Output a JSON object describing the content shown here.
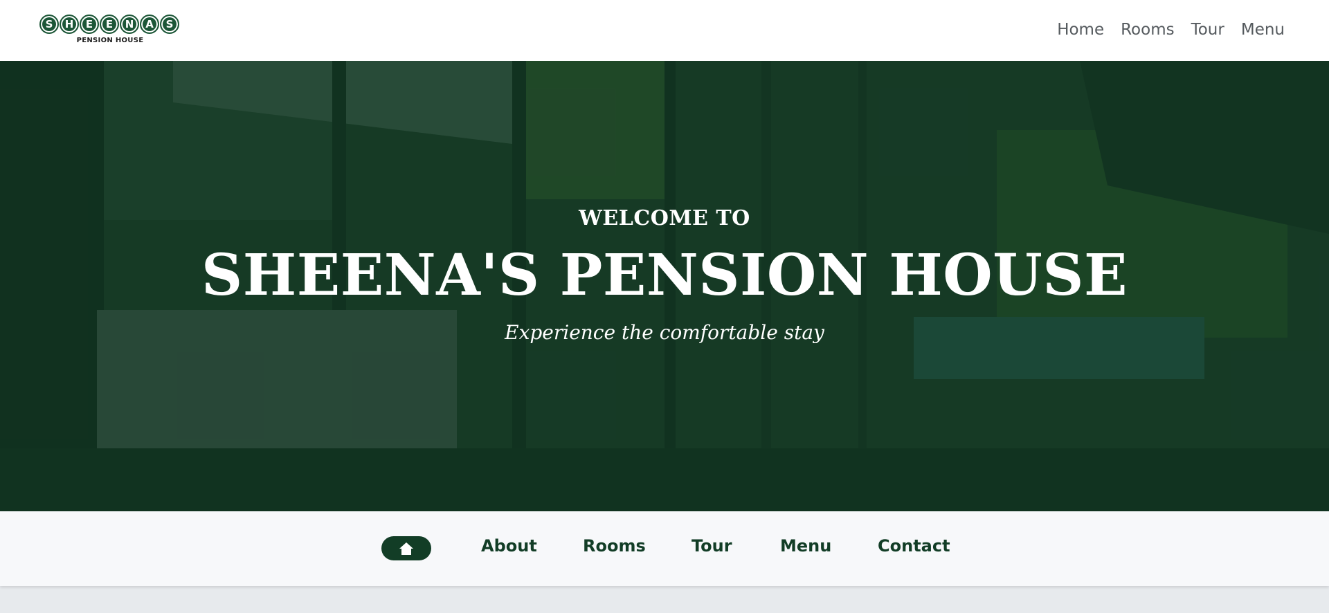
{
  "logo": {
    "letters": [
      "S",
      "H",
      "E",
      "E",
      "N",
      "A",
      "S"
    ],
    "subtitle": "PENSION HOUSE"
  },
  "top_nav": {
    "items": [
      "Home",
      "Rooms",
      "Tour",
      "Menu"
    ]
  },
  "hero": {
    "welcome": "WELCOME TO",
    "title": "SHEENA'S PENSION HOUSE",
    "tagline": "Experience the comfortable stay"
  },
  "section_nav": {
    "home_icon": "home-icon",
    "items": [
      "About",
      "Rooms",
      "Tour",
      "Menu",
      "Contact"
    ]
  },
  "colors": {
    "brand_green": "#123d26",
    "logo_green": "#1c5637",
    "hero_overlay": "#0e3420",
    "nav_text": "#555a5e"
  }
}
